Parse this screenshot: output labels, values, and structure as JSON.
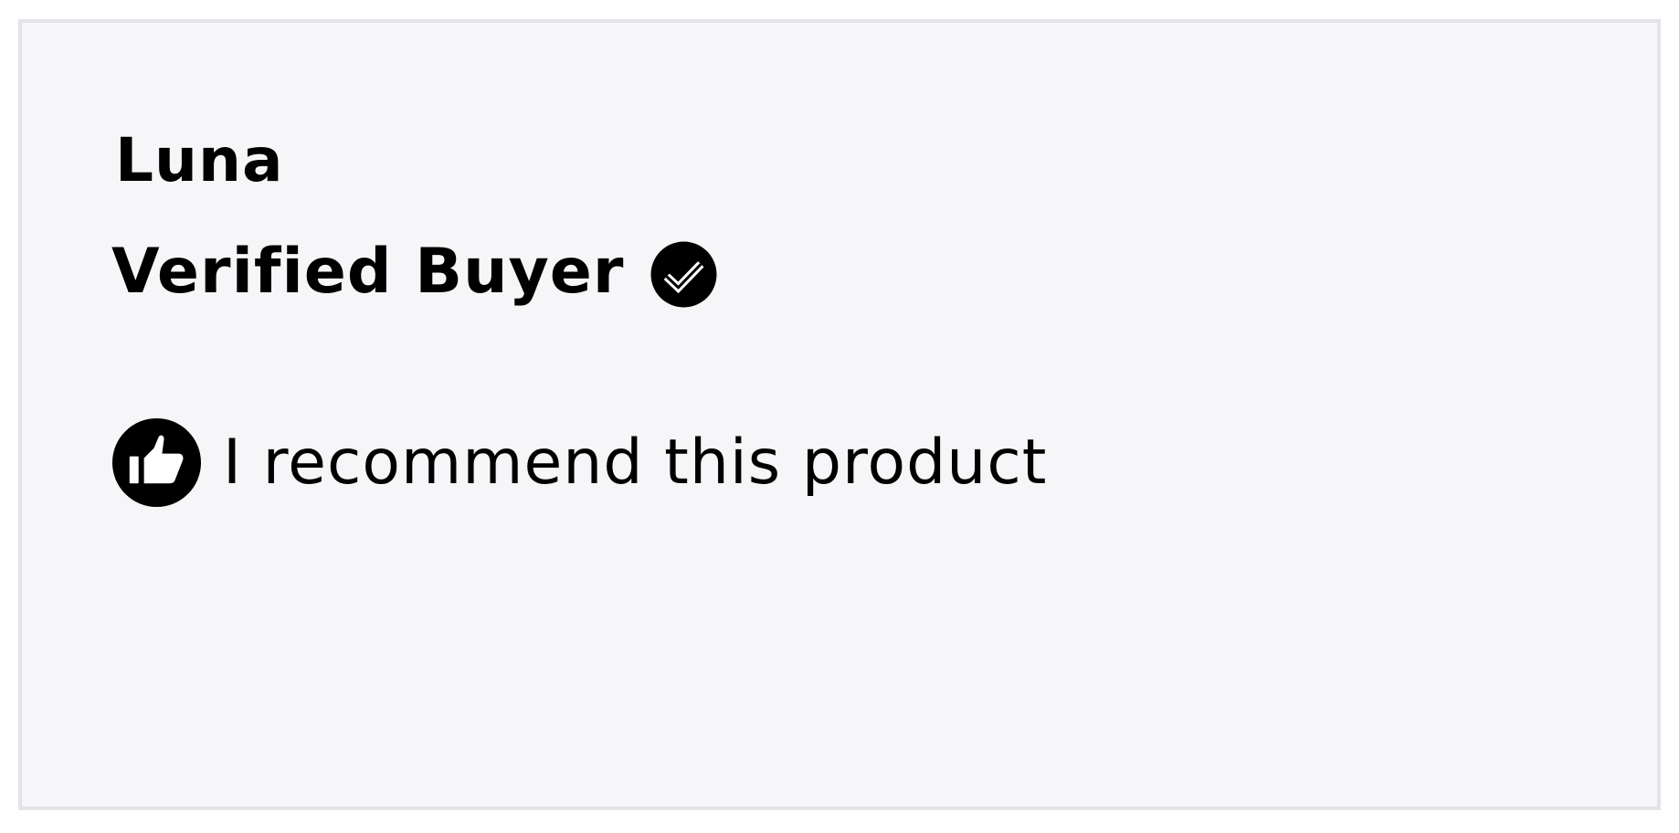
{
  "review": {
    "reviewer_name": "Luna",
    "verified_label": "Verified Buyer",
    "verified_icon": "verified-check-icon",
    "recommend_text": "I recommend this product",
    "recommend_icon": "thumbs-up-icon"
  },
  "colors": {
    "card_background": "#f6f6f8",
    "card_border": "#e3e3e8",
    "text": "#000000",
    "icon_fill": "#000000"
  }
}
